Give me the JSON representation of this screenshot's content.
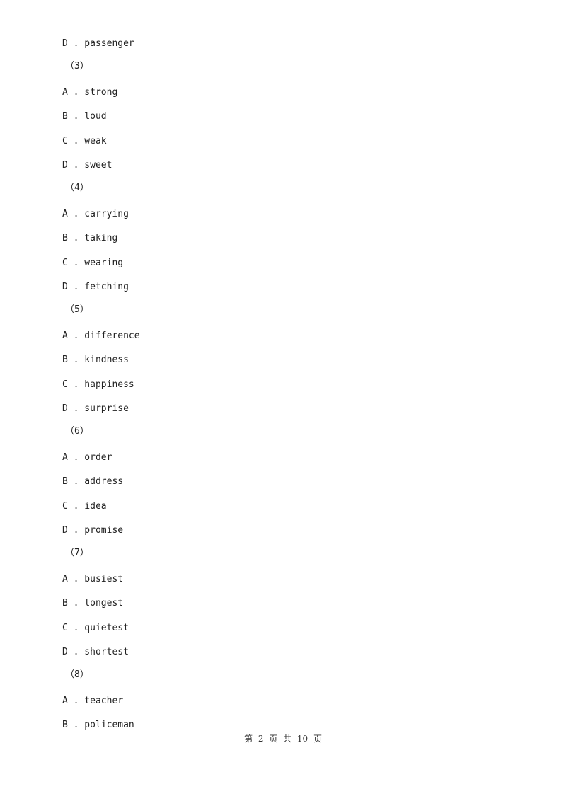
{
  "lines": [
    {
      "type": "option",
      "text": "D . passenger"
    },
    {
      "type": "qnum",
      "text": "（3）"
    },
    {
      "type": "option",
      "text": "A . strong"
    },
    {
      "type": "option",
      "text": "B . loud"
    },
    {
      "type": "option",
      "text": "C . weak"
    },
    {
      "type": "option",
      "text": "D . sweet"
    },
    {
      "type": "qnum",
      "text": "（4）"
    },
    {
      "type": "option",
      "text": "A . carrying"
    },
    {
      "type": "option",
      "text": "B . taking"
    },
    {
      "type": "option",
      "text": "C . wearing"
    },
    {
      "type": "option",
      "text": "D . fetching"
    },
    {
      "type": "qnum",
      "text": "（5）"
    },
    {
      "type": "option",
      "text": "A . difference"
    },
    {
      "type": "option",
      "text": "B . kindness"
    },
    {
      "type": "option",
      "text": "C . happiness"
    },
    {
      "type": "option",
      "text": "D . surprise"
    },
    {
      "type": "qnum",
      "text": "（6）"
    },
    {
      "type": "option",
      "text": "A . order"
    },
    {
      "type": "option",
      "text": "B . address"
    },
    {
      "type": "option",
      "text": "C . idea"
    },
    {
      "type": "option",
      "text": "D . promise"
    },
    {
      "type": "qnum",
      "text": "（7）"
    },
    {
      "type": "option",
      "text": "A . busiest"
    },
    {
      "type": "option",
      "text": "B . longest"
    },
    {
      "type": "option",
      "text": "C . quietest"
    },
    {
      "type": "option",
      "text": "D . shortest"
    },
    {
      "type": "qnum",
      "text": "（8）"
    },
    {
      "type": "option",
      "text": "A . teacher"
    },
    {
      "type": "option",
      "text": "B . policeman"
    }
  ],
  "footer": {
    "text": "第 2 页 共 10 页"
  }
}
